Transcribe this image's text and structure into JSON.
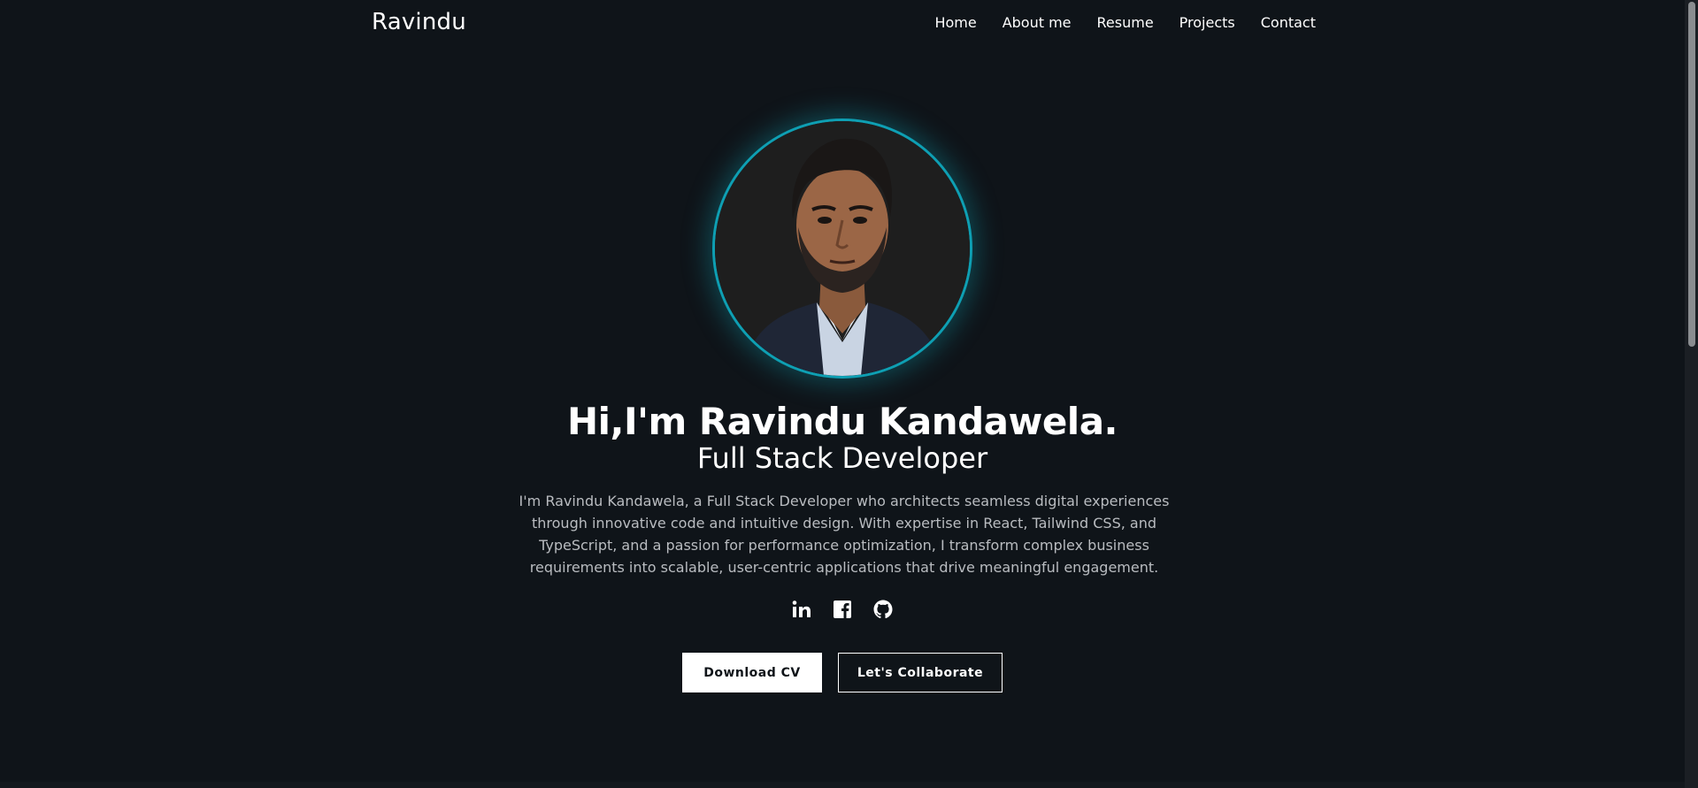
{
  "nav": {
    "brand": "Ravindu",
    "links": [
      "Home",
      "About me",
      "Resume",
      "Projects",
      "Contact"
    ]
  },
  "hero": {
    "headline": "Hi,I'm Ravindu Kandawela.",
    "subheadline": "Full Stack Developer",
    "bio": "I'm Ravindu Kandawela, a Full Stack Developer who architects seamless digital experiences through innovative code and intuitive design. With expertise in React, Tailwind CSS, and TypeScript, and a passion for performance optimization, I transform complex business requirements into scalable, user-centric applications that drive meaningful engagement.",
    "socials": [
      "linkedin-icon",
      "facebook-icon",
      "github-icon"
    ],
    "buttons": {
      "primary": "Download CV",
      "secondary": "Let's Collaborate"
    }
  },
  "colors": {
    "background": "#0f1419",
    "accent": "#0e9fb3",
    "text": "#ffffff",
    "muted_text": "#b9bcc0"
  }
}
